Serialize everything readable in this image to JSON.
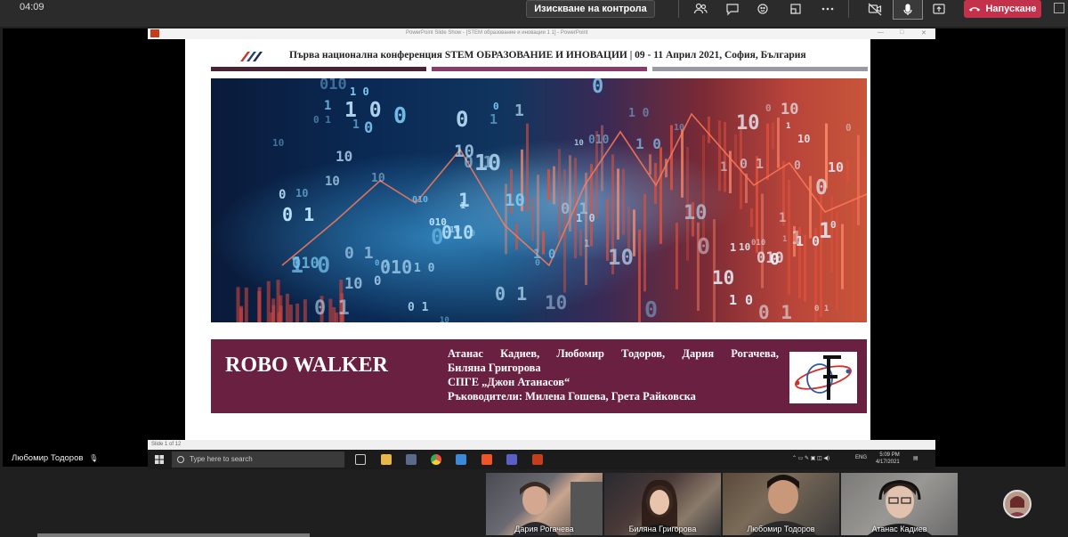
{
  "meeting": {
    "timer": "04:09",
    "request_control_label": "Изискване на контрола",
    "hangup_label": "Напускане"
  },
  "presenter": {
    "name": "Любомир Тодоров"
  },
  "ppt_window": {
    "title": "PowerPoint Slide Show - [STEM образование и иновации 1 1] - PowerPoint",
    "status": "Slide 1 of 12"
  },
  "slide": {
    "conference_title": "Първа национална конференция  STEM ОБРАЗОВАНИЕ И ИНОВАЦИИ | 09 - 11 Април 2021, София, България",
    "project_title": "ROBO WALKER",
    "authors_line1": "Атанас Кадиев, Любомир Тодоров, Дария Рогачева,",
    "authors_line2": "Биляна Григорова",
    "school": "СПГЕ „Джон Атанасов“",
    "supervisors": "Ръководители: Милена Гошева, Грета Райковска",
    "hero_digits": [
      "0",
      "1",
      "10",
      "0 1",
      "1 0",
      "10",
      "010",
      "0",
      "10",
      "1"
    ]
  },
  "taskbar": {
    "search_placeholder": "Type here to search",
    "lang": "ENG",
    "time": "5:09 PM",
    "date": "4/17/2021"
  },
  "participants": [
    {
      "name": "Дария Рогачева"
    },
    {
      "name": "Биляна Григорова"
    },
    {
      "name": "Любомир Тодоров"
    },
    {
      "name": "Атанас Кадиев"
    }
  ],
  "colors": {
    "stripe1": "#4a2234",
    "stripe2": "#8c3a6a",
    "stripe3": "#9a9aa4",
    "footer_band": "#6a2141",
    "hangup": "#c4314b"
  }
}
